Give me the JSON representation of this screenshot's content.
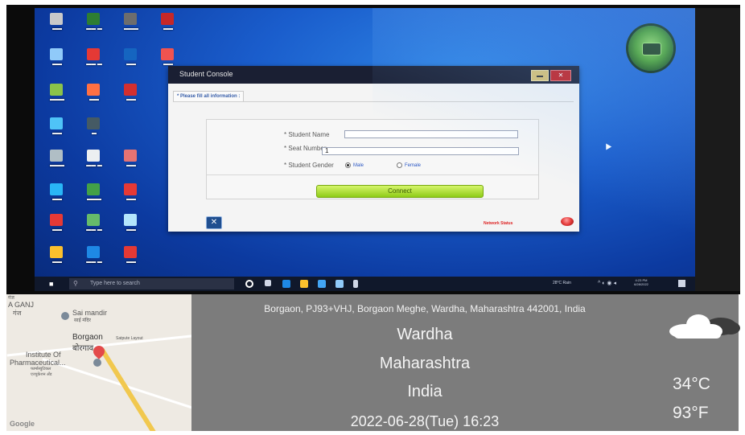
{
  "window": {
    "title": "Student Console",
    "section_label": "* Please fill all information :",
    "fields": {
      "student_name_label": "* Student Name",
      "student_name_value": "",
      "seat_number_label": "* Seat Number",
      "seat_number_value": "1",
      "gender_label": "* Student Gender",
      "gender_options": [
        "Male",
        "Female"
      ],
      "gender_selected": "Male"
    },
    "connect_label": "Connect",
    "network_status_label": "Network Status"
  },
  "taskbar": {
    "search_placeholder": "Type here to search",
    "weather": "28°C Rain",
    "time": "4:23 PM",
    "date": "6/28/2022"
  },
  "map": {
    "place_a": "A GANJ",
    "place_a_local": "गंज",
    "poi_1": "Sai mandir",
    "poi_1_local": "साई मंदिर",
    "place_b": "Borgaon",
    "place_b_local": "बोरगाव",
    "layout": "Satpute Layout",
    "poi_2": "Institute Of",
    "poi_2_line2": "Pharmaceutical...",
    "poi_2_local": "फार्मास्युटिकल",
    "poi_2_local2": "एज्युकेशन अँड",
    "attribution": "Google"
  },
  "geotag": {
    "address": "Borgaon, PJ93+VHJ, Borgaon Meghe, Wardha, Maharashtra 442001, India",
    "city": "Wardha",
    "state": "Maharashtra",
    "country": "India",
    "datetime": "2022-06-28(Tue)   16:23",
    "temp_c": "34°C",
    "temp_f": "93°F",
    "weather_icon": "cloud-icon"
  },
  "colors": {
    "titlebar": "#1a1f33",
    "connect": "#8fcc18",
    "overlay": "#7c7c7c",
    "desktop": "#1a5dcc"
  }
}
